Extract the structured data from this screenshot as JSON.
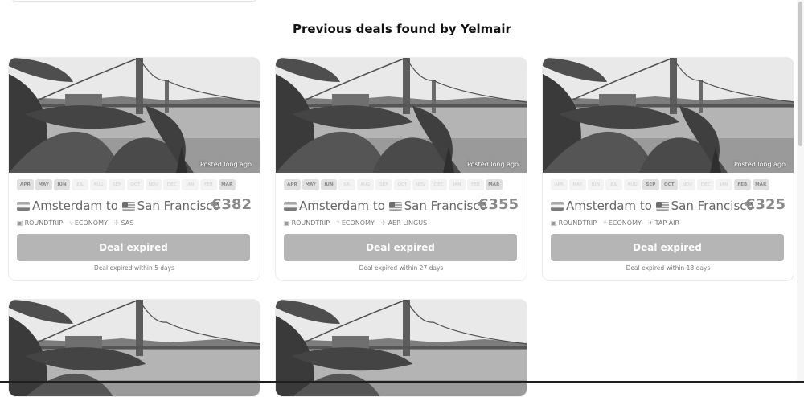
{
  "heading": "Previous deals found by Yelmair",
  "months": [
    "APR",
    "MAY",
    "JUN",
    "JUL",
    "AUG",
    "SEP",
    "OCT",
    "NOV",
    "DEC",
    "JAN",
    "FEB",
    "MAR"
  ],
  "cards": [
    {
      "posted": "Posted long ago",
      "active_months": [
        "APR",
        "MAY",
        "JUN",
        "MAR"
      ],
      "origin": "Amsterdam",
      "to_word": "to",
      "destination": "San Francisco",
      "price": "€382",
      "trip_type": "ROUNDTRIP",
      "cabin": "ECONOMY",
      "airline": "SAS",
      "button": "Deal expired",
      "note": "Deal expired within 5 days"
    },
    {
      "posted": "Posted long ago",
      "active_months": [
        "APR",
        "MAY",
        "JUN",
        "MAR"
      ],
      "origin": "Amsterdam",
      "to_word": "to",
      "destination": "San Francisco",
      "price": "€355",
      "trip_type": "ROUNDTRIP",
      "cabin": "ECONOMY",
      "airline": "AER LINGUS",
      "button": "Deal expired",
      "note": "Deal expired within 27 days"
    },
    {
      "posted": "Posted long ago",
      "active_months": [
        "SEP",
        "OCT",
        "FEB",
        "MAR"
      ],
      "origin": "Amsterdam",
      "to_word": "to",
      "destination": "San Francisco",
      "price": "€325",
      "trip_type": "ROUNDTRIP",
      "cabin": "ECONOMY",
      "airline": "TAP AIR",
      "button": "Deal expired",
      "note": "Deal expired within 13 days"
    }
  ],
  "icons": {
    "trip": "calendar-icon",
    "cabin": "seat-icon",
    "airline": "plane-icon"
  }
}
